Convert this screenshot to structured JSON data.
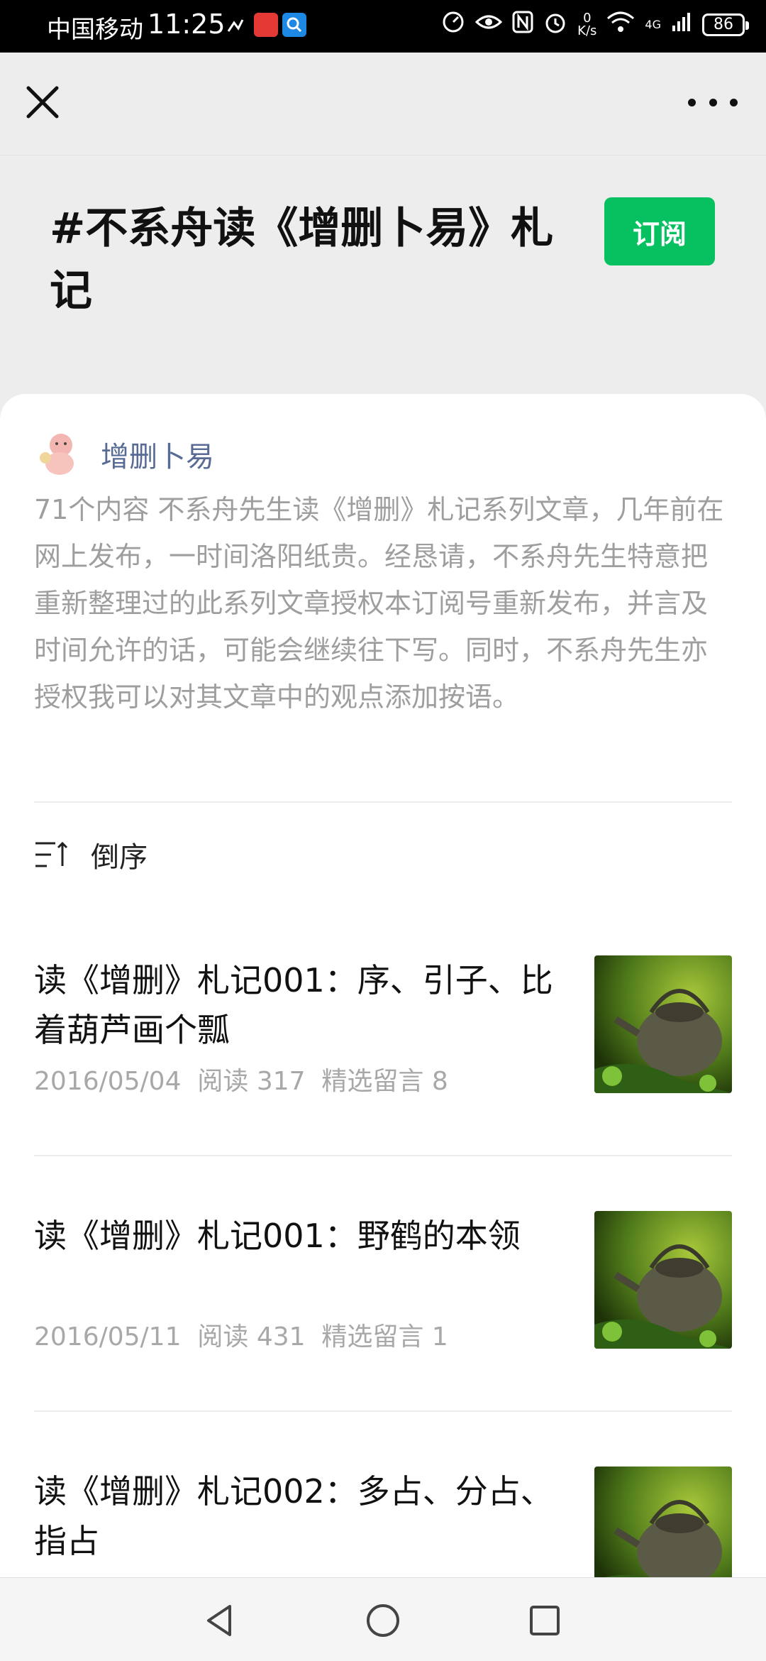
{
  "status_bar": {
    "carrier": "中国移动",
    "time": "11:25",
    "net_speed_value": "0",
    "net_speed_unit": "K/s",
    "network": "4G",
    "battery": "86"
  },
  "header": {
    "close_icon": "close-icon",
    "more_icon": "more-icon"
  },
  "topic": {
    "title": "#不系舟读《增删卜易》札记",
    "subscribe_label": "订阅"
  },
  "account": {
    "name": "增删卜易",
    "description": "71个内容  不系舟先生读《增删》札记系列文章，几年前在网上发布，一时间洛阳纸贵。经恳请，不系舟先生特意把重新整理过的此系列文章授权本订阅号重新发布，并言及时间允许的话，可能会继续往下写。同时，不系舟先生亦授权我可以对其文章中的观点添加按语。"
  },
  "sort": {
    "label": "倒序"
  },
  "articles": [
    {
      "title": "读《增删》札记001：序、引子、比着葫芦画个瓢",
      "meta": "2016/05/04  阅读 317  精选留言 8"
    },
    {
      "title": "读《增删》札记001：野鹤的本领",
      "meta": "2016/05/11  阅读 431  精选留言 1"
    },
    {
      "title": "读《增删》札记002：多占、分占、指占",
      "meta": ""
    }
  ],
  "nav": {
    "back_icon": "back-icon",
    "home_icon": "home-icon",
    "recents_icon": "recents-icon"
  }
}
